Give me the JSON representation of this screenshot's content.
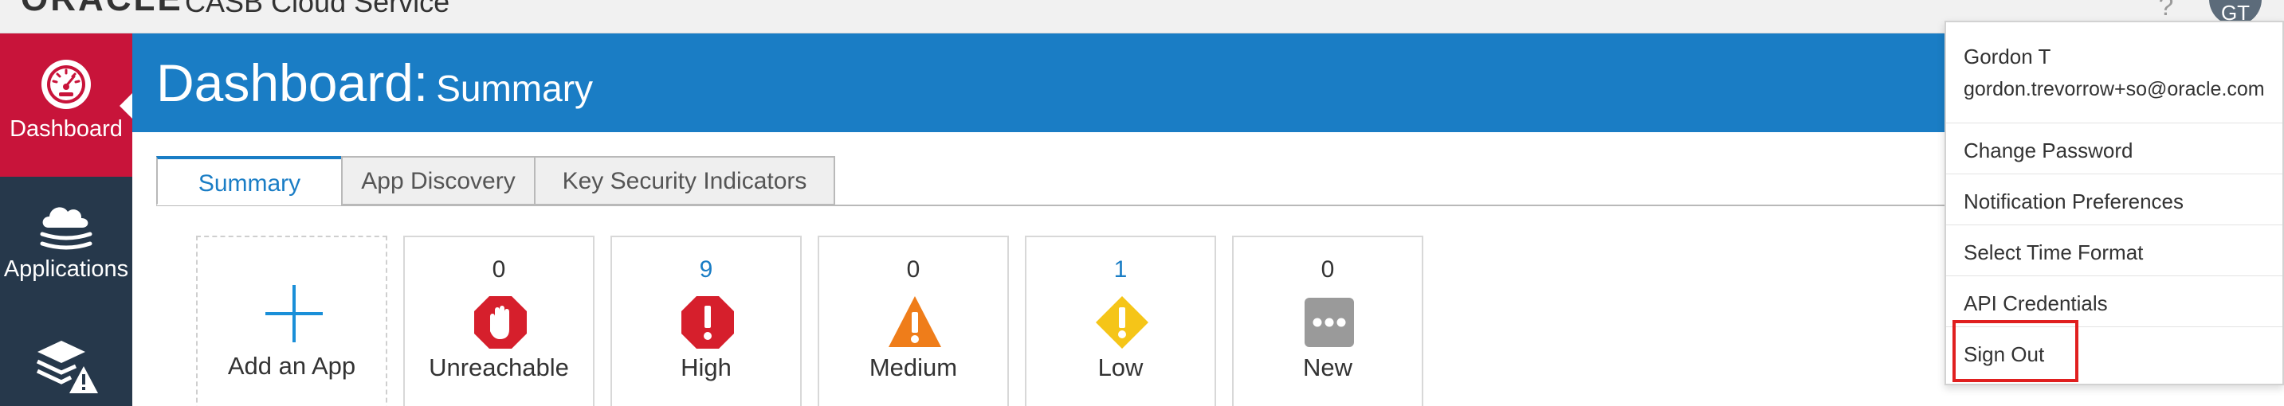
{
  "topbar": {
    "logo_text": "ORACLE",
    "product_name": "CASB Cloud Service",
    "help_icon": "question-mark-icon",
    "avatar_initials": "GT"
  },
  "sidebar": {
    "items": [
      {
        "label": "Dashboard",
        "icon": "speedometer-icon",
        "active": true
      },
      {
        "label": "Applications",
        "icon": "cloud-stack-icon",
        "active": false
      },
      {
        "label": "",
        "icon": "layers-warning-icon",
        "active": false
      }
    ],
    "active_color": "#c8143a",
    "background_color": "#26384b"
  },
  "header": {
    "title": "Dashboard:",
    "subtitle": "Summary",
    "background_color": "#1a7dc5"
  },
  "tabs": [
    {
      "label": "Summary",
      "active": true
    },
    {
      "label": "App Discovery",
      "active": false
    },
    {
      "label": "Key Security Indicators",
      "active": false
    }
  ],
  "cards": {
    "add_app": {
      "label": "Add an App",
      "icon": "plus-icon"
    },
    "risk": [
      {
        "count": "0",
        "label": "Unreachable",
        "icon": "stop-hand-icon",
        "color": "#d61f2c"
      },
      {
        "count": "9",
        "label": "High",
        "icon": "octagon-exclamation-icon",
        "color": "#d61f2c"
      },
      {
        "count": "0",
        "label": "Medium",
        "icon": "triangle-exclamation-icon",
        "color": "#ef7d1a"
      },
      {
        "count": "1",
        "label": "Low",
        "icon": "diamond-exclamation-icon",
        "color": "#f5c518"
      },
      {
        "count": "0",
        "label": "New",
        "icon": "ellipsis-icon",
        "color": "#9a9a9a"
      }
    ]
  },
  "user_menu": {
    "name": "Gordon T",
    "email": "gordon.trevorrow+so@oracle.com",
    "items": [
      "Change Password",
      "Notification Preferences",
      "Select Time Format",
      "API Credentials",
      "Sign Out"
    ],
    "highlight_color": "#e01f1f"
  }
}
